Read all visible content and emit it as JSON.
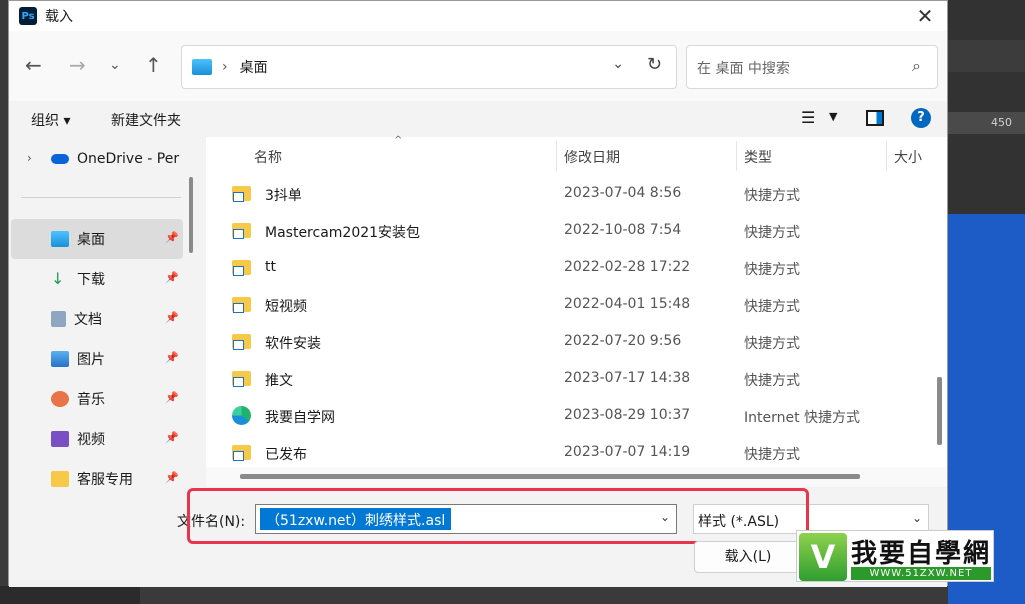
{
  "window": {
    "title": "载入",
    "app_icon": "Ps"
  },
  "nav": {
    "address_location": "桌面",
    "search_placeholder": "在 桌面 中搜索"
  },
  "commands": {
    "organize": "组织",
    "new_folder": "新建文件夹"
  },
  "sidebar": {
    "onedrive": "OneDrive - Per",
    "items": [
      {
        "label": "桌面",
        "icon": "desktop-icon",
        "selected": true
      },
      {
        "label": "下载",
        "icon": "download-icon"
      },
      {
        "label": "文档",
        "icon": "document-icon"
      },
      {
        "label": "图片",
        "icon": "pictures-icon"
      },
      {
        "label": "音乐",
        "icon": "music-icon"
      },
      {
        "label": "视频",
        "icon": "video-icon"
      },
      {
        "label": "客服专用",
        "icon": "folder-icon"
      }
    ]
  },
  "columns": {
    "name": "名称",
    "modified": "修改日期",
    "type": "类型",
    "size": "大小"
  },
  "files": [
    {
      "name": "3抖单",
      "modified": "2023-07-04 8:56",
      "type": "快捷方式"
    },
    {
      "name": "Mastercam2021安装包",
      "modified": "2022-10-08 7:54",
      "type": "快捷方式"
    },
    {
      "name": "tt",
      "modified": "2022-02-28 17:22",
      "type": "快捷方式"
    },
    {
      "name": "短视频",
      "modified": "2022-04-01 15:48",
      "type": "快捷方式"
    },
    {
      "name": "软件安装",
      "modified": "2022-07-20 9:56",
      "type": "快捷方式"
    },
    {
      "name": "推文",
      "modified": "2023-07-17 14:38",
      "type": "快捷方式"
    },
    {
      "name": "我要自学网",
      "modified": "2023-08-29 10:37",
      "type": "Internet 快捷方式"
    },
    {
      "name": "已发布",
      "modified": "2023-07-07 14:19",
      "type": "快捷方式"
    }
  ],
  "bottom": {
    "filename_label": "文件名(N):",
    "filename_value": "（51zxw.net）刺绣样式.asl",
    "filetype": "样式 (*.ASL)",
    "load_button": "载入(L)"
  },
  "background": {
    "ruler_value": "450"
  },
  "watermark": {
    "title": "我要自學網",
    "url": "WWW.51ZXW.NET"
  },
  "colors": {
    "accent": "#0078d4",
    "highlight": "#e8344d",
    "ps_blue": "#1d5bc7"
  }
}
